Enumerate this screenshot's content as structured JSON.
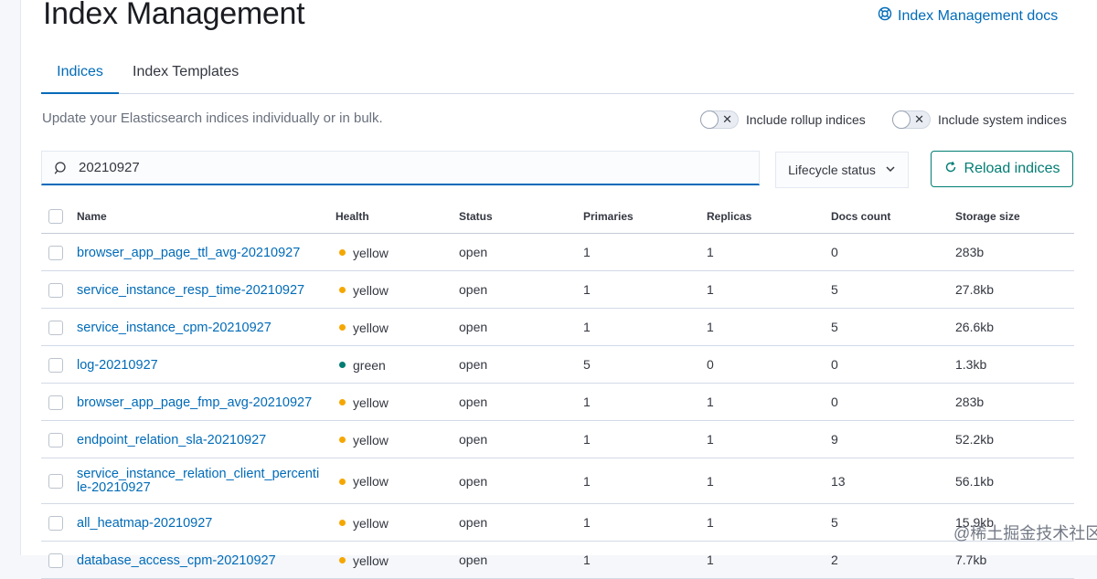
{
  "page": {
    "title": "Index Management",
    "docs_link": "Index Management docs",
    "tabs": [
      "Indices",
      "Index Templates"
    ],
    "description": "Update your Elasticsearch indices individually or in bulk.",
    "toggles": [
      {
        "label": "Include rollup indices",
        "on": false
      },
      {
        "label": "Include system indices",
        "on": false
      }
    ],
    "search_value": "20210927",
    "lifecycle_label": "Lifecycle status",
    "reload_label": "Reload indices",
    "watermark": "@稀土掘金技术社区"
  },
  "colors": {
    "yellow": "#f5a700",
    "green": "#017d73",
    "link": "#006bb8"
  },
  "icons": [
    "help-circle-icon",
    "search-icon",
    "chevron-down-icon",
    "refresh-icon",
    "close-icon"
  ],
  "table": {
    "columns": [
      "Name",
      "Health",
      "Status",
      "Primaries",
      "Replicas",
      "Docs count",
      "Storage size"
    ],
    "rows": [
      {
        "name": "browser_app_page_ttl_avg-20210927",
        "health": "yellow",
        "status": "open",
        "primaries": "1",
        "replicas": "1",
        "docs": "0",
        "size": "283b"
      },
      {
        "name": "service_instance_resp_time-20210927",
        "health": "yellow",
        "status": "open",
        "primaries": "1",
        "replicas": "1",
        "docs": "5",
        "size": "27.8kb"
      },
      {
        "name": "service_instance_cpm-20210927",
        "health": "yellow",
        "status": "open",
        "primaries": "1",
        "replicas": "1",
        "docs": "5",
        "size": "26.6kb"
      },
      {
        "name": "log-20210927",
        "health": "green",
        "status": "open",
        "primaries": "5",
        "replicas": "0",
        "docs": "0",
        "size": "1.3kb"
      },
      {
        "name": "browser_app_page_fmp_avg-20210927",
        "health": "yellow",
        "status": "open",
        "primaries": "1",
        "replicas": "1",
        "docs": "0",
        "size": "283b"
      },
      {
        "name": "endpoint_relation_sla-20210927",
        "health": "yellow",
        "status": "open",
        "primaries": "1",
        "replicas": "1",
        "docs": "9",
        "size": "52.2kb"
      },
      {
        "name": "service_instance_relation_client_percentile-20210927",
        "name_lines": [
          "service_instance_relation_client_percenti",
          "le-20210927"
        ],
        "health": "yellow",
        "status": "open",
        "primaries": "1",
        "replicas": "1",
        "docs": "13",
        "size": "56.1kb"
      },
      {
        "name": "all_heatmap-20210927",
        "health": "yellow",
        "status": "open",
        "primaries": "1",
        "replicas": "1",
        "docs": "5",
        "size": "15.9kb"
      },
      {
        "name": "database_access_cpm-20210927",
        "health": "yellow",
        "status": "open",
        "primaries": "1",
        "replicas": "1",
        "docs": "2",
        "size": "7.7kb"
      }
    ]
  }
}
